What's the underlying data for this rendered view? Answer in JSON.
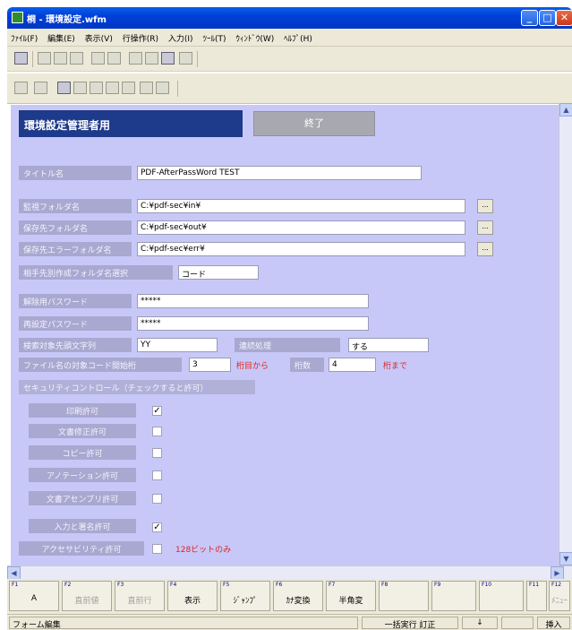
{
  "window": {
    "title": "桐 - 環境設定.wfm"
  },
  "menu": [
    "ﾌｧｲﾙ(F)",
    "編集(E)",
    "表示(V)",
    "行操作(R)",
    "入力(I)",
    "ﾂｰﾙ(T)",
    "ｳｨﾝﾄﾞｳ(W)",
    "ﾍﾙﾌﾟ(H)"
  ],
  "form": {
    "header": "環境設定管理者用",
    "end_button": "終了",
    "title_label": "タイトル名",
    "title_value": "PDF-AfterPassWord  TEST",
    "watch_folder_label": "監視フォルダ名",
    "watch_folder_value": "C:¥pdf-sec¥in¥",
    "save_folder_label": "保存先フォルダ名",
    "save_folder_value": "C:¥pdf-sec¥out¥",
    "error_folder_label": "保存先エラーフォルダ名",
    "error_folder_value": "C:¥pdf-sec¥err¥",
    "browse_label": "...",
    "partner_folder_label": "相手先別作成フォルダ名選択",
    "partner_folder_value": "コード",
    "unlock_pw_label": "解除用パスワード",
    "unlock_pw_value": "*****",
    "reset_pw_label": "再設定パスワード",
    "reset_pw_value": "*****",
    "search_prefix_label": "検索対象先頭文字列",
    "search_prefix_value": "YY",
    "continue_label": "連続処理",
    "continue_value": "する",
    "filename_code_label": "ファイル名の対象コード開始桁",
    "filename_code_start": "3",
    "from_digit_text": "桁目から",
    "digits_label": "桁数",
    "digits_value": "4",
    "to_digit_text": "桁まで",
    "security_label": "セキュリティコントロール（チェックすると許可）",
    "permissions": [
      {
        "label": "印刷許可",
        "checked": true
      },
      {
        "label": "文書修正許可",
        "checked": false
      },
      {
        "label": "コピー許可",
        "checked": false
      },
      {
        "label": "アノテーション許可",
        "checked": false
      },
      {
        "label": "文書アセンブリ許可",
        "checked": false
      },
      {
        "label": "入力と署名許可",
        "checked": true
      },
      {
        "label": "アクセサビリティ許可",
        "checked": false
      }
    ],
    "bit128_note": "128ビットのみ"
  },
  "fkeys": [
    {
      "num": "F1",
      "label": "A",
      "enabled": true
    },
    {
      "num": "F2",
      "label": "直前値",
      "enabled": false
    },
    {
      "num": "F3",
      "label": "直前行",
      "enabled": false
    },
    {
      "num": "F4",
      "label": "表示",
      "enabled": true
    },
    {
      "num": "F5",
      "label": "ｼﾞｬﾝﾌﾟ",
      "enabled": true
    },
    {
      "num": "F6",
      "label": "ｶﾅ変換",
      "enabled": true
    },
    {
      "num": "F7",
      "label": "半角変",
      "enabled": true
    },
    {
      "num": "F8",
      "label": "",
      "enabled": false
    },
    {
      "num": "F9",
      "label": "",
      "enabled": false
    },
    {
      "num": "F10",
      "label": "",
      "enabled": false
    },
    {
      "num": "F11",
      "label": "",
      "enabled": false
    },
    {
      "num": "F12",
      "label": "ﾒﾆｭｰ",
      "enabled": false
    }
  ],
  "status": {
    "mode": "フォーム編集",
    "batch": "一括実行 訂正",
    "arrow": "↓",
    "insert": "挿入"
  }
}
